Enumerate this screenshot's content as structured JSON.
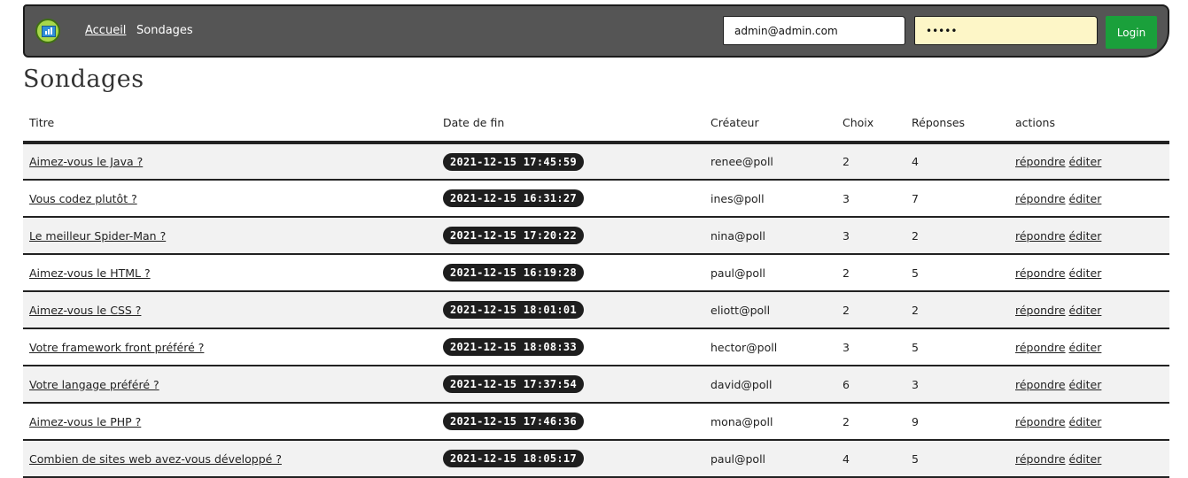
{
  "nav": {
    "home_label": "Accueil",
    "current_label": "Sondages",
    "email_value": "admin@admin.com",
    "password_value": "•••••",
    "login_label": "Login"
  },
  "page": {
    "title": "Sondages"
  },
  "table": {
    "headers": {
      "title": "Titre",
      "end_date": "Date de fin",
      "creator": "Créateur",
      "choices": "Choix",
      "answers": "Réponses",
      "actions": "actions"
    },
    "action_labels": {
      "answer": "répondre",
      "edit": "éditer"
    },
    "rows": [
      {
        "title": "Aimez-vous le Java ?",
        "date": "2021-12-15 17:45:59",
        "creator": "renee@poll",
        "choices": "2",
        "answers": "4"
      },
      {
        "title": "Vous codez plutôt ?",
        "date": "2021-12-15 16:31:27",
        "creator": "ines@poll",
        "choices": "3",
        "answers": "7"
      },
      {
        "title": "Le meilleur Spider-Man ?",
        "date": "2021-12-15 17:20:22",
        "creator": "nina@poll",
        "choices": "3",
        "answers": "2"
      },
      {
        "title": "Aimez-vous le HTML ?",
        "date": "2021-12-15 16:19:28",
        "creator": "paul@poll",
        "choices": "2",
        "answers": "5"
      },
      {
        "title": "Aimez-vous le CSS ?",
        "date": "2021-12-15 18:01:01",
        "creator": "eliott@poll",
        "choices": "2",
        "answers": "2"
      },
      {
        "title": "Votre framework front préféré ?",
        "date": "2021-12-15 18:08:33",
        "creator": "hector@poll",
        "choices": "3",
        "answers": "5"
      },
      {
        "title": "Votre langage préféré ?",
        "date": "2021-12-15 17:37:54",
        "creator": "david@poll",
        "choices": "6",
        "answers": "3"
      },
      {
        "title": "Aimez-vous le PHP ?",
        "date": "2021-12-15 17:46:36",
        "creator": "mona@poll",
        "choices": "2",
        "answers": "9"
      },
      {
        "title": "Combien de sites web avez-vous développé ?",
        "date": "2021-12-15 18:05:17",
        "creator": "paul@poll",
        "choices": "4",
        "answers": "5"
      }
    ]
  }
}
